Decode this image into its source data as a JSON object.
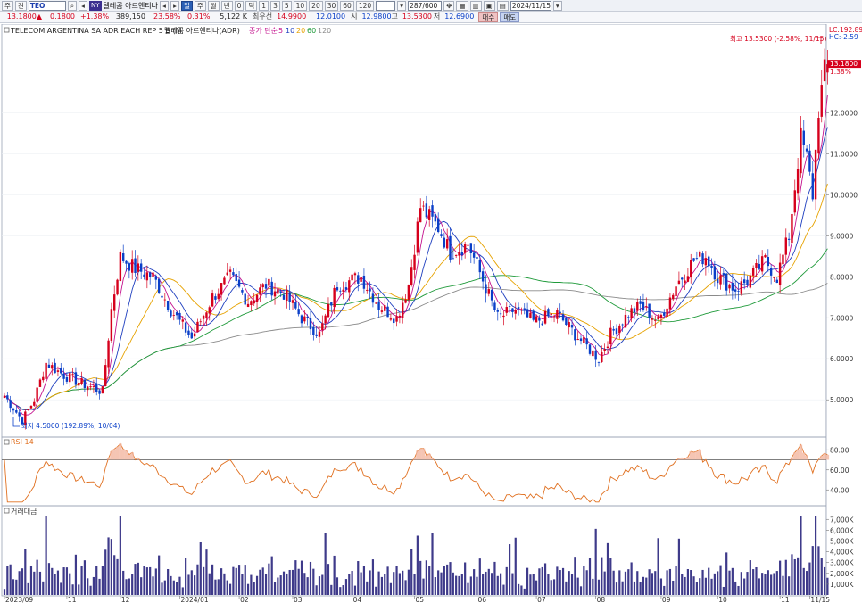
{
  "toolbar": {
    "market_btn": "주",
    "period_btn": "견",
    "symbol_code": "TEO",
    "badge": "NY",
    "symbol_name": "텔레콤 아르헨티나",
    "period_buttons": [
      "일",
      "주",
      "월",
      "년",
      "0",
      "틱"
    ],
    "minute_buttons": [
      "1",
      "3",
      "5",
      "10",
      "20",
      "30",
      "60",
      "120"
    ],
    "count": "287/600",
    "date": "2024/11/15"
  },
  "quote": {
    "price": "13.1800",
    "price_arrow": "▲",
    "change": "0.1800",
    "change_pct": "+1.38%",
    "volume": "389,150",
    "ratio1": "23.58%",
    "ratio2": "0.31%",
    "shares": "5,122 K",
    "label_best": "최우선",
    "best_ask": "14.9900",
    "best_bid": "12.0100",
    "label_open": "시",
    "open": "12.9800",
    "label_high": "고",
    "high": "13.5300",
    "label_low": "저",
    "low": "12.6900",
    "buy_label": "매수",
    "sell_label": "매도"
  },
  "colors": {
    "up": "#d6001c",
    "down": "#0a3fc8",
    "ma5": "#c4148f",
    "ma10": "#1f3fbf",
    "ma20": "#e6a200",
    "ma60": "#1f9a3a",
    "ma120": "#8a8a8a",
    "rsi": "#e07020",
    "volume": "#3e3a8a"
  },
  "chart_data": [
    {
      "type": "candlestick",
      "title": "TELECOM ARGENTINA SA ADR EACH REP 5 B (M",
      "subtitle": "텔레콤 아르헨티나(ADR)",
      "legend_label": "종가 단순",
      "legend": [
        "5",
        "10",
        "20",
        "60",
        "120"
      ],
      "x_ticks": [
        {
          "i": 0,
          "label": "2023/09"
        },
        {
          "i": 21,
          "label": "11"
        },
        {
          "i": 39,
          "label": "12"
        },
        {
          "i": 59,
          "label": "2024/01"
        },
        {
          "i": 79,
          "label": "02"
        },
        {
          "i": 97,
          "label": "03"
        },
        {
          "i": 117,
          "label": "04"
        },
        {
          "i": 138,
          "label": "05"
        },
        {
          "i": 159,
          "label": "06"
        },
        {
          "i": 179,
          "label": "07"
        },
        {
          "i": 199,
          "label": "08"
        },
        {
          "i": 221,
          "label": "09"
        },
        {
          "i": 240,
          "label": "10"
        },
        {
          "i": 261,
          "label": "11"
        },
        {
          "i": 271,
          "label": "11/15"
        }
      ],
      "y_ticks": [
        "12.0000",
        "11.0000",
        "10.0000",
        "9.0000",
        "8.0000",
        "7.0000",
        "6.0000",
        "5.0000"
      ],
      "ylim": [
        4.2,
        13.9
      ],
      "anchors": [
        [
          0,
          5.1
        ],
        [
          6,
          4.5
        ],
        [
          10,
          5.0
        ],
        [
          14,
          5.9
        ],
        [
          20,
          5.6
        ],
        [
          26,
          5.4
        ],
        [
          33,
          5.2
        ],
        [
          36,
          7.2
        ],
        [
          39,
          8.5
        ],
        [
          44,
          8.2
        ],
        [
          50,
          8.0
        ],
        [
          56,
          7.2
        ],
        [
          63,
          6.5
        ],
        [
          70,
          7.5
        ],
        [
          76,
          8.0
        ],
        [
          82,
          7.4
        ],
        [
          88,
          7.8
        ],
        [
          94,
          7.6
        ],
        [
          100,
          7.0
        ],
        [
          106,
          6.6
        ],
        [
          112,
          7.8
        ],
        [
          120,
          8.0
        ],
        [
          126,
          7.3
        ],
        [
          132,
          7.0
        ],
        [
          136,
          7.8
        ],
        [
          140,
          9.7
        ],
        [
          146,
          9.2
        ],
        [
          150,
          8.6
        ],
        [
          156,
          8.8
        ],
        [
          160,
          8.1
        ],
        [
          166,
          7.0
        ],
        [
          172,
          7.2
        ],
        [
          178,
          6.9
        ],
        [
          186,
          7.1
        ],
        [
          192,
          6.6
        ],
        [
          200,
          6.0
        ],
        [
          204,
          6.6
        ],
        [
          210,
          7.1
        ],
        [
          214,
          7.3
        ],
        [
          220,
          6.9
        ],
        [
          226,
          7.8
        ],
        [
          232,
          8.4
        ],
        [
          236,
          8.5
        ],
        [
          240,
          8.0
        ],
        [
          246,
          7.7
        ],
        [
          250,
          7.9
        ],
        [
          256,
          8.4
        ],
        [
          260,
          8.0
        ],
        [
          264,
          9.0
        ],
        [
          268,
          11.4
        ],
        [
          270,
          10.9
        ],
        [
          272,
          10.0
        ],
        [
          274,
          12.1
        ],
        [
          276,
          13.0
        ],
        [
          277,
          13.18
        ]
      ],
      "high_note": "최고 13.5300 (-2.58%, 11/15)",
      "low_note": "최저 4.5000 (192.89%, 10/04)",
      "lc_label": "LC:192.89",
      "hc_label": "HC:-2.59",
      "last_price": "13.1800",
      "last_pct": "1.38%"
    },
    {
      "type": "line",
      "title": "RSI 14",
      "y_ticks": [
        "80.00",
        "60.00",
        "40.00"
      ],
      "ylim": [
        26,
        90
      ],
      "levels": [
        70,
        30
      ]
    },
    {
      "type": "bar",
      "title": "거래대금",
      "y_ticks": [
        "7,000K",
        "6,000K",
        "5,000K",
        "4,000K",
        "3,000K",
        "2,000K",
        "1,000K"
      ],
      "ylim": [
        0,
        7600
      ]
    }
  ]
}
